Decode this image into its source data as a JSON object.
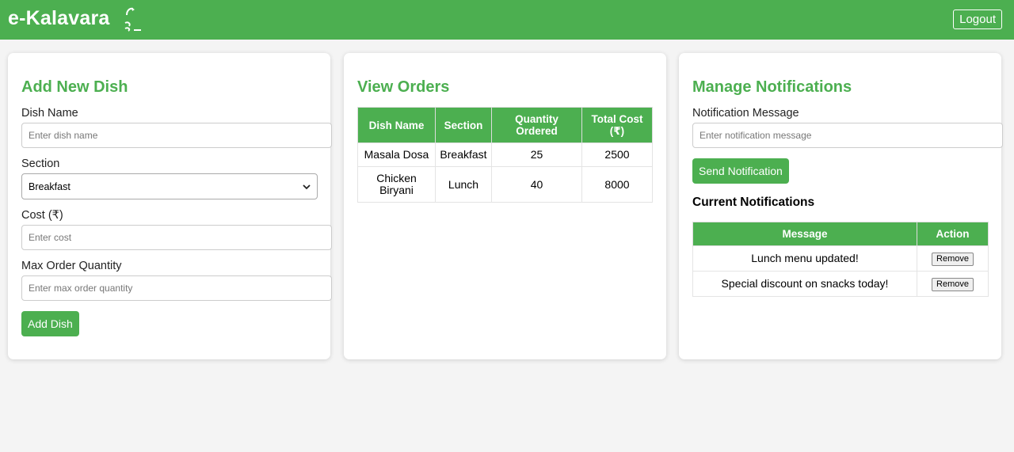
{
  "header": {
    "brand": "e-Kalavara",
    "logout_label": "Logout",
    "accent_color": "#4caf50"
  },
  "add_dish": {
    "title": "Add New Dish",
    "dish_name_label": "Dish Name",
    "dish_name_placeholder": "Enter dish name",
    "section_label": "Section",
    "section_selected": "Breakfast",
    "cost_label": "Cost (₹)",
    "cost_placeholder": "Enter cost",
    "max_qty_label": "Max Order Quantity",
    "max_qty_placeholder": "Enter max order quantity",
    "submit_label": "Add Dish"
  },
  "orders": {
    "title": "View Orders",
    "columns": [
      "Dish Name",
      "Section",
      "Quantity Ordered",
      "Total Cost (₹)"
    ],
    "rows": [
      [
        "Masala Dosa",
        "Breakfast",
        "25",
        "2500"
      ],
      [
        "Chicken Biryani",
        "Lunch",
        "40",
        "8000"
      ]
    ]
  },
  "notifications": {
    "title": "Manage Notifications",
    "message_label": "Notification Message",
    "message_placeholder": "Enter notification message",
    "send_label": "Send Notification",
    "current_title": "Current Notifications",
    "columns": [
      "Message",
      "Action"
    ],
    "rows": [
      {
        "message": "Lunch menu updated!",
        "action": "Remove"
      },
      {
        "message": "Special discount on snacks today!",
        "action": "Remove"
      }
    ]
  }
}
